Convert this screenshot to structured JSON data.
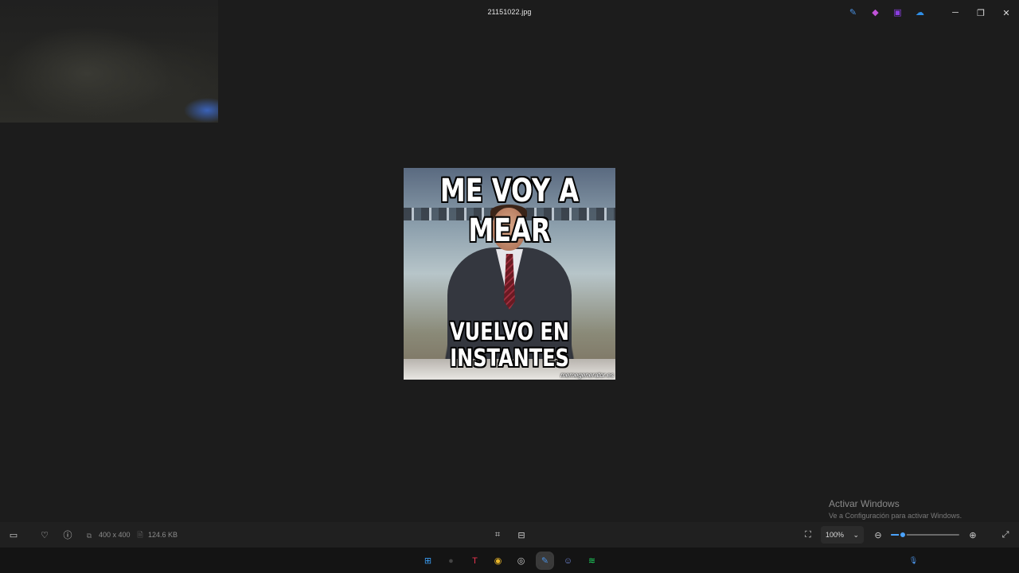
{
  "window": {
    "title": "21151022.jpg"
  },
  "tray_icons": [
    {
      "name": "photo-editor-icon",
      "glyph": "✎",
      "color": "#4a90e2"
    },
    {
      "name": "designer-icon",
      "glyph": "◆",
      "color": "#c052d8"
    },
    {
      "name": "clipchamp-icon",
      "glyph": "▣",
      "color": "#8a3ee0"
    },
    {
      "name": "onedrive-icon",
      "glyph": "☁",
      "color": "#2f8fe8"
    }
  ],
  "window_controls": {
    "minimize": "─",
    "restore": "❐",
    "close": "✕"
  },
  "meme": {
    "top_text": "ME VOY A MEAR",
    "bottom_text": "VUELVO EN INSTANTES",
    "watermark": "memegenerator.es"
  },
  "activation": {
    "title": "Activar Windows",
    "subtitle": "Ve a Configuración para activar Windows."
  },
  "status": {
    "dimensions": "400 x 400",
    "file_size": "124.6 KB",
    "zoom_level": "100%",
    "zoom_slider_value": 0.17
  },
  "icons": {
    "filmstrip": "▭",
    "favorite": "♡",
    "info": "ⓘ",
    "dims": "⧉",
    "size": "🗎",
    "crop": "⌗",
    "ocr": "⊟",
    "fit": "⛶",
    "zoom_chevron": "⌄",
    "zoom_out": "⊖",
    "zoom_in": "⊕",
    "fullscreen": "⤢"
  },
  "taskbar": [
    {
      "name": "windows-start-icon",
      "glyph": "⊞",
      "color": "#3a9bf0",
      "active": false
    },
    {
      "name": "search-icon",
      "glyph": "●",
      "color": "#444444",
      "active": false
    },
    {
      "name": "text-app-icon",
      "glyph": "T",
      "color": "#e8344e",
      "active": false
    },
    {
      "name": "chrome-icon",
      "glyph": "◉",
      "color": "#e9b62a",
      "active": false
    },
    {
      "name": "opera-gx-icon",
      "glyph": "◎",
      "color": "#cfcfcf",
      "active": false
    },
    {
      "name": "photos-icon",
      "glyph": "✎",
      "color": "#4a90e2",
      "active": true
    },
    {
      "name": "discord-icon",
      "glyph": "☺",
      "color": "#7289da",
      "active": false
    },
    {
      "name": "spotify-icon",
      "glyph": "≋",
      "color": "#1ed760",
      "active": false
    }
  ],
  "mic_icon": "🎙"
}
